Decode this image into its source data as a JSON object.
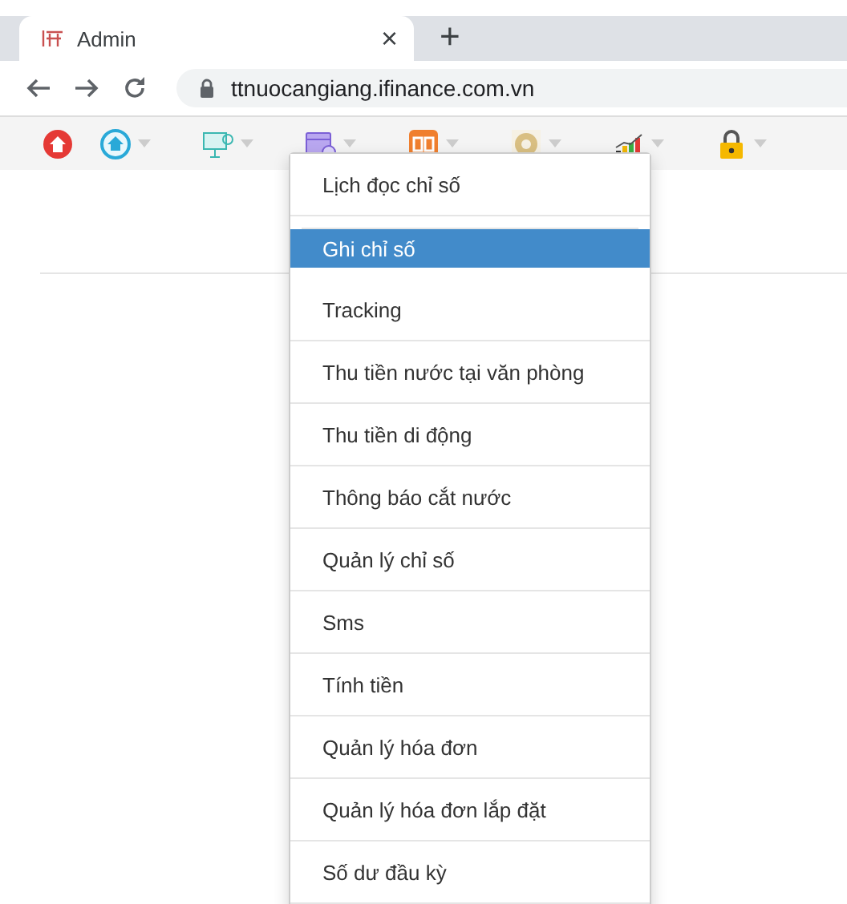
{
  "browser": {
    "tab": {
      "title": "Admin",
      "close": "×"
    },
    "new_tab": "+",
    "url": "ttnuocangiang.ifinance.com.vn"
  },
  "toolbar": [
    {
      "kind": "home-red",
      "caret": false
    },
    {
      "kind": "home",
      "caret": true
    },
    {
      "kind": "screen",
      "caret": true
    },
    {
      "kind": "card",
      "caret": true
    },
    {
      "kind": "book",
      "caret": true
    },
    {
      "kind": "coin",
      "caret": true
    },
    {
      "kind": "chart",
      "caret": true
    },
    {
      "kind": "lock",
      "caret": true
    }
  ],
  "menu": [
    {
      "label": "Lịch đọc chỉ số",
      "selected": false
    },
    {
      "label": "Ghi chỉ số",
      "selected": true
    },
    {
      "label": "Tracking",
      "selected": false
    },
    {
      "label": "Thu tiền nước tại văn phòng",
      "selected": false
    },
    {
      "label": "Thu tiền di động",
      "selected": false
    },
    {
      "label": "Thông báo cắt nước",
      "selected": false
    },
    {
      "label": "Quản lý chỉ số",
      "selected": false
    },
    {
      "label": "Sms",
      "selected": false
    },
    {
      "label": "Tính tiền",
      "selected": false
    },
    {
      "label": "Quản lý hóa đơn",
      "selected": false
    },
    {
      "label": "Quản lý hóa đơn lắp đặt",
      "selected": false
    },
    {
      "label": "Số dư đầu kỳ",
      "selected": false
    }
  ]
}
